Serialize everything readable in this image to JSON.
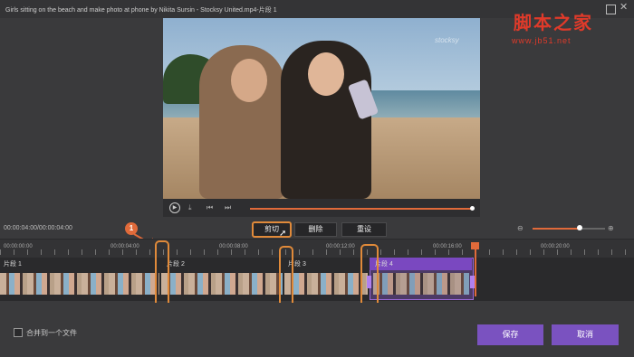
{
  "window": {
    "title": "Girls sitting on the beach and make photo at phone by Nikita Sursin - Stocksy United.mp4-片段 1",
    "watermark": "脚本之家",
    "watermark_url": "www.jb51.net"
  },
  "video": {
    "stock_mark": "stocksy",
    "progress": 1.0
  },
  "editor": {
    "timecode": "00:00:04:00/00:00:04:00",
    "cut_label": "剪切",
    "delete_label": "删除",
    "reset_label": "重设",
    "zoom_level": 0.65
  },
  "ruler": {
    "ticks": [
      "00:00:00:00",
      "00:00:04:00",
      "00:00:08:00",
      "00:00:12:00",
      "00:00:16:00",
      "00:00:20:00"
    ]
  },
  "segments": [
    "片段 1",
    "片段 2",
    "片段 3",
    "片段 4"
  ],
  "callout": {
    "number": "1"
  },
  "footer": {
    "merge_label": "合并到一个文件",
    "save_label": "保存",
    "cancel_label": "取消"
  },
  "colors": {
    "accent": "#e06a3a",
    "purple": "#7a52c0"
  }
}
